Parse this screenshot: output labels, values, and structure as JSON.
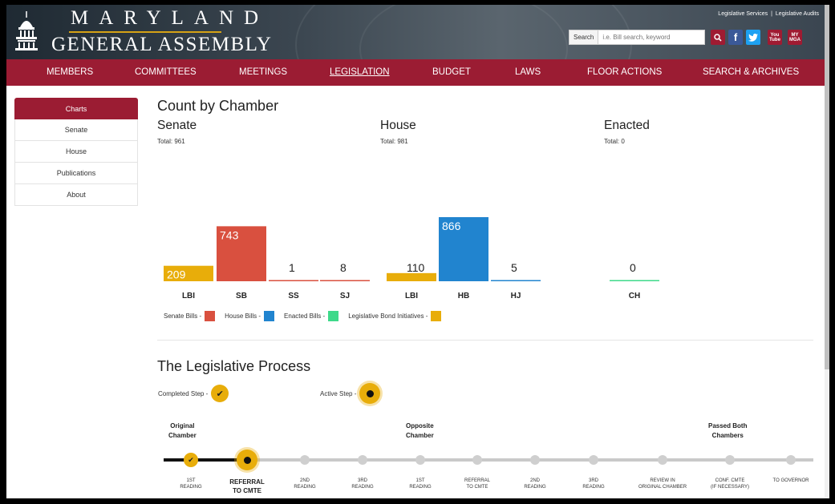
{
  "header": {
    "logo_top": "MARYLAND",
    "logo_bottom": "GENERAL ASSEMBLY",
    "top_links": [
      "Legislative Services",
      "|",
      "Legislative Audits"
    ],
    "search_label": "Search",
    "search_placeholder": "i.e. Bill search, keyword",
    "youtube_label_1": "You",
    "youtube_label_2": "Tube",
    "mga_label_1": "MY",
    "mga_label_2": "MGA",
    "fb_label": "f",
    "twitter_icon": "twitter-bird-icon",
    "search_icon": "magnifier-icon"
  },
  "nav": {
    "items": [
      {
        "label": "MEMBERS"
      },
      {
        "label": "COMMITTEES"
      },
      {
        "label": "MEETINGS"
      },
      {
        "label": "LEGISLATION",
        "active": true
      },
      {
        "label": "BUDGET"
      },
      {
        "label": "LAWS"
      },
      {
        "label": "FLOOR ACTIONS"
      },
      {
        "label": "SEARCH & ARCHIVES"
      }
    ]
  },
  "sidebar": {
    "items": [
      {
        "label": "Charts",
        "active": true
      },
      {
        "label": "Senate"
      },
      {
        "label": "House"
      },
      {
        "label": "Publications"
      },
      {
        "label": "About"
      }
    ]
  },
  "count_by_chamber": {
    "title": "Count by Chamber",
    "chambers": [
      {
        "name": "Senate",
        "total": "Total: 961"
      },
      {
        "name": "House",
        "total": "Total: 981"
      },
      {
        "name": "Enacted",
        "total": "Total: 0"
      }
    ]
  },
  "chart_data": {
    "type": "bar",
    "categories": [
      "LBI",
      "SB",
      "SS",
      "SJ",
      "LBI",
      "HB",
      "HJ",
      "CH"
    ],
    "values": [
      209,
      743,
      1,
      8,
      110,
      866,
      5,
      0
    ],
    "series_colors": [
      "#e8ad0a",
      "#d9503f",
      "#d9503f",
      "#d9503f",
      "#e8ad0a",
      "#2184cf",
      "#2184cf",
      "#3ed98a"
    ],
    "legend": [
      {
        "label": "Senate Bills -",
        "color": "#d9503f"
      },
      {
        "label": "House Bills -",
        "color": "#2184cf"
      },
      {
        "label": "Enacted Bills -",
        "color": "#3ed98a"
      },
      {
        "label": "Legislative Bond Initiatives -",
        "color": "#e8ad0a"
      }
    ],
    "title": "",
    "xlabel": "",
    "ylabel": ""
  },
  "process": {
    "title": "The Legislative Process",
    "completed_label": "Completed Step -",
    "active_label": "Active Step -",
    "phases": [
      {
        "line1": "Original",
        "line2": "Chamber"
      },
      {
        "line1": "Opposite",
        "line2": "Chamber"
      },
      {
        "line1": "Passed Both",
        "line2": "Chambers"
      }
    ],
    "steps": [
      {
        "line1": "1ST",
        "line2": "READING",
        "status": "done"
      },
      {
        "line1": "REFERRAL",
        "line2": "TO CMTE",
        "status": "active"
      },
      {
        "line1": "2ND",
        "line2": "READING",
        "status": "pending"
      },
      {
        "line1": "3RD",
        "line2": "READING",
        "status": "pending"
      },
      {
        "line1": "1ST",
        "line2": "READING",
        "status": "pending"
      },
      {
        "line1": "REFERRAL",
        "line2": "TO CMTE",
        "status": "pending"
      },
      {
        "line1": "2ND",
        "line2": "READING",
        "status": "pending"
      },
      {
        "line1": "3RD",
        "line2": "READING",
        "status": "pending"
      },
      {
        "line1": "REVIEW IN",
        "line2": "ORIGINAL CHAMBER",
        "status": "pending"
      },
      {
        "line1": "CONF. CMTE",
        "line2": "(IF NECESSARY)",
        "status": "pending"
      },
      {
        "line1": "TO GOVERNOR",
        "line2": "",
        "status": "pending"
      }
    ]
  }
}
